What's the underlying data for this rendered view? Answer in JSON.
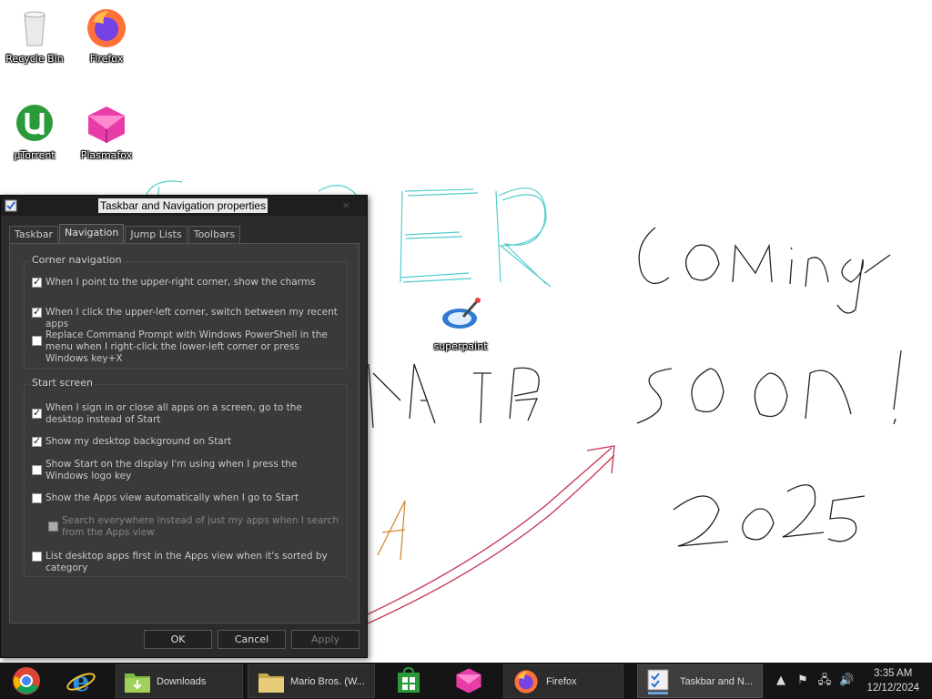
{
  "desktop": {
    "icons": [
      {
        "label": "Recycle Bin"
      },
      {
        "label": "Firefox"
      },
      {
        "label": "µTorrent"
      },
      {
        "label": "Plasmafox"
      },
      {
        "label": "superpaint"
      }
    ],
    "wallpaper_colors": {
      "cyan": "#40c8c8",
      "black": "#222222",
      "crimson": "#c83050",
      "orange": "#d08a30"
    }
  },
  "dialog": {
    "title": "Taskbar and Navigation properties",
    "tabs": [
      "Taskbar",
      "Navigation",
      "Jump Lists",
      "Toolbars"
    ],
    "active_tab": "Navigation",
    "groups": [
      {
        "title": "Corner navigation",
        "options": [
          {
            "text": "When I point to the upper-right corner, show the charms",
            "checked": true,
            "enabled": true
          },
          {
            "text": "When I click the upper-left corner, switch between my recent apps",
            "checked": true,
            "enabled": true
          },
          {
            "text": "Replace Command Prompt with Windows PowerShell in the menu when I right-click the lower-left corner or press Windows key+X",
            "checked": false,
            "enabled": true
          }
        ]
      },
      {
        "title": "Start screen",
        "options": [
          {
            "text": "When I sign in or close all apps on a screen, go to the desktop instead of Start",
            "checked": true,
            "enabled": true
          },
          {
            "text": "Show my desktop background on Start",
            "checked": true,
            "enabled": true
          },
          {
            "text": "Show Start on the display I'm using when I press the Windows logo key",
            "checked": false,
            "enabled": true
          },
          {
            "text": "Show the Apps view automatically when I go to Start",
            "checked": false,
            "enabled": true
          },
          {
            "text": "Search everywhere instead of just my apps when I search from the Apps view",
            "checked": false,
            "enabled": false
          },
          {
            "text": "List desktop apps first in the Apps view when it's sorted by category",
            "checked": false,
            "enabled": true
          }
        ]
      }
    ],
    "buttons": {
      "ok": "OK",
      "cancel": "Cancel",
      "apply": "Apply"
    }
  },
  "taskbar": {
    "items": [
      {
        "label": "",
        "icon": "chrome-icon"
      },
      {
        "label": "",
        "icon": "internet-explorer-icon"
      },
      {
        "label": "Downloads",
        "icon": "folder-icon"
      },
      {
        "label": "Mario Bros. (W...",
        "icon": "folder-icon"
      },
      {
        "label": "",
        "icon": "store-icon"
      },
      {
        "label": "",
        "icon": "plasmafox-icon"
      },
      {
        "label": "Firefox",
        "icon": "firefox-icon"
      },
      {
        "label": "Taskbar and N...",
        "icon": "properties-icon"
      }
    ],
    "clock": {
      "time": "3:35 AM",
      "date": "12/12/2024"
    }
  }
}
